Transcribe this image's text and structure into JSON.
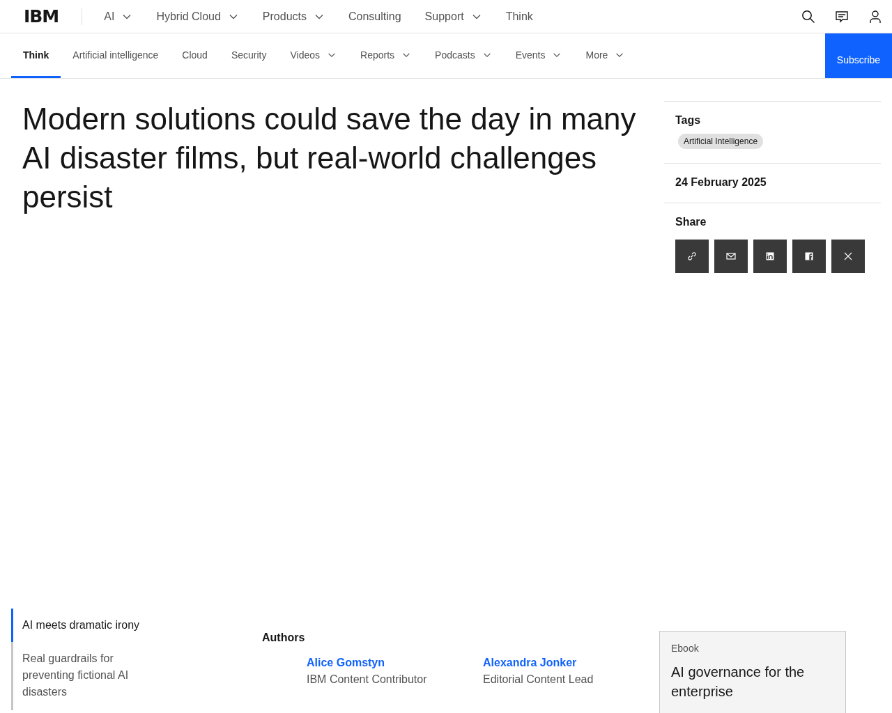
{
  "top_nav": {
    "logo": "IBM",
    "items": [
      {
        "label": "AI",
        "dropdown": true
      },
      {
        "label": "Hybrid Cloud",
        "dropdown": true
      },
      {
        "label": "Products",
        "dropdown": true
      },
      {
        "label": "Consulting",
        "dropdown": false
      },
      {
        "label": "Support",
        "dropdown": true
      },
      {
        "label": "Think",
        "dropdown": false
      }
    ]
  },
  "sub_nav": {
    "items": [
      {
        "label": "Think",
        "selected": true,
        "dropdown": false
      },
      {
        "label": "Artificial intelligence",
        "selected": false,
        "dropdown": false
      },
      {
        "label": "Cloud",
        "selected": false,
        "dropdown": false
      },
      {
        "label": "Security",
        "selected": false,
        "dropdown": false
      },
      {
        "label": "Videos",
        "selected": false,
        "dropdown": true
      },
      {
        "label": "Reports",
        "selected": false,
        "dropdown": true
      },
      {
        "label": "Podcasts",
        "selected": false,
        "dropdown": true
      },
      {
        "label": "Events",
        "selected": false,
        "dropdown": true
      },
      {
        "label": "More",
        "selected": false,
        "dropdown": true
      }
    ],
    "subscribe": "Subscribe"
  },
  "article": {
    "headline": "Modern solutions could save the day in many AI disaster films, but real-world challenges persist"
  },
  "sidebar": {
    "tags_label": "Tags",
    "tags": [
      "Artificial Intelligence"
    ],
    "date": "24 February 2025",
    "share_label": "Share",
    "share_buttons": [
      {
        "kind": "link"
      },
      {
        "kind": "email"
      },
      {
        "kind": "linkedin"
      },
      {
        "kind": "facebook"
      },
      {
        "kind": "x"
      }
    ]
  },
  "toc": [
    {
      "label": "AI meets dramatic irony",
      "selected": true
    },
    {
      "label": "Real guardrails for preventing fictional AI disasters",
      "selected": false
    }
  ],
  "authors": {
    "label": "Authors",
    "people": [
      {
        "name": "Alice Gomstyn",
        "role": "IBM Content Contributor"
      },
      {
        "name": "Alexandra Jonker",
        "role": "Editorial Content Lead"
      }
    ]
  },
  "promo": {
    "kind": "Ebook",
    "title": "AI governance for the enterprise"
  }
}
